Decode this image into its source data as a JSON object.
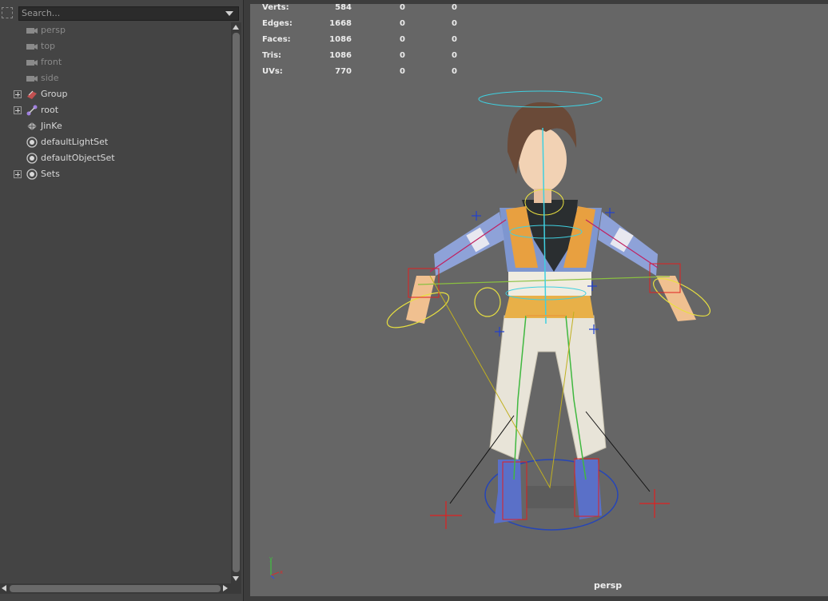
{
  "outliner": {
    "search_placeholder": "Search...",
    "items": [
      {
        "label": "persp",
        "icon": "camera-icon",
        "dim": true,
        "expandable": false
      },
      {
        "label": "top",
        "icon": "camera-icon",
        "dim": true,
        "expandable": false
      },
      {
        "label": "front",
        "icon": "camera-icon",
        "dim": true,
        "expandable": false
      },
      {
        "label": "side",
        "icon": "camera-icon",
        "dim": true,
        "expandable": false
      },
      {
        "label": "Group",
        "icon": "group-icon",
        "dim": false,
        "expandable": true
      },
      {
        "label": "root",
        "icon": "joint-icon",
        "dim": false,
        "expandable": true
      },
      {
        "label": "JinKe",
        "icon": "mesh-icon",
        "dim": false,
        "expandable": false
      },
      {
        "label": "defaultLightSet",
        "icon": "set-icon",
        "dim": false,
        "expandable": false
      },
      {
        "label": "defaultObjectSet",
        "icon": "set-icon",
        "dim": false,
        "expandable": false
      },
      {
        "label": "Sets",
        "icon": "set-icon",
        "dim": false,
        "expandable": true
      }
    ]
  },
  "viewport": {
    "camera_label": "persp",
    "hud": [
      {
        "key": "Verts:",
        "v1": "584",
        "v2": "0",
        "v3": "0"
      },
      {
        "key": "Edges:",
        "v1": "1668",
        "v2": "0",
        "v3": "0"
      },
      {
        "key": "Faces:",
        "v1": "1086",
        "v2": "0",
        "v3": "0"
      },
      {
        "key": "Tris:",
        "v1": "1086",
        "v2": "0",
        "v3": "0"
      },
      {
        "key": "UVs:",
        "v1": "770",
        "v2": "0",
        "v3": "0"
      }
    ]
  },
  "colors": {
    "panel_bg": "#444444",
    "viewport_bg": "#666666",
    "rig_cyan": "#3fd0e0",
    "rig_yellow": "#e8e040",
    "rig_red": "#e02020",
    "rig_blue": "#2040d0"
  }
}
